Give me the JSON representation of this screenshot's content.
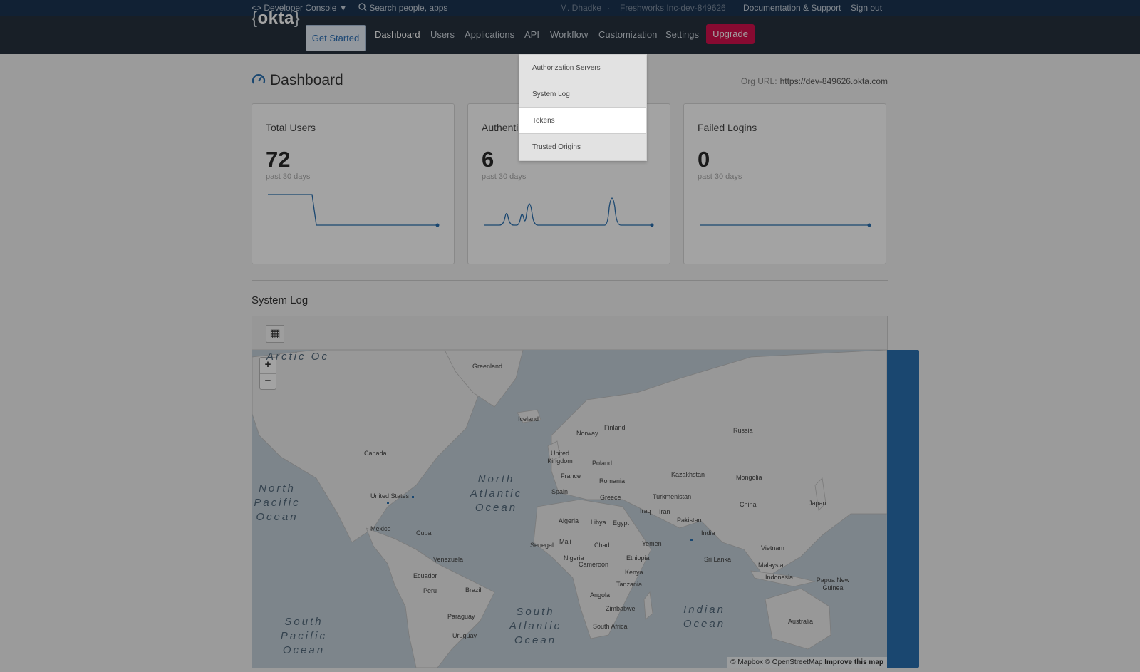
{
  "topbar": {
    "console_label": "Developer Console",
    "search_placeholder": "Search people, apps",
    "user": "M. Dhadke",
    "org": "Freshworks Inc-dev-849626",
    "docs": "Documentation & Support",
    "signout": "Sign out"
  },
  "nav": {
    "logo": "okta",
    "get_started": "Get Started",
    "links": [
      "Dashboard",
      "Users",
      "Applications",
      "API",
      "Workflow",
      "Customization",
      "Settings"
    ],
    "upgrade": "Upgrade",
    "api_menu": [
      "Authorization Servers",
      "System Log",
      "Tokens",
      "Trusted Origins"
    ],
    "highlighted_menu_item": "Tokens"
  },
  "page": {
    "title": "Dashboard",
    "org_url_label": "Org URL:",
    "org_url": "https://dev-849626.okta.com"
  },
  "cards": [
    {
      "title": "Total Users",
      "value": "72",
      "sub": "past 30 days"
    },
    {
      "title": "Authenti",
      "value": "6",
      "sub": "past 30 days"
    },
    {
      "title": "Failed Logins",
      "value": "0",
      "sub": "past 30 days"
    }
  ],
  "system_log": {
    "title": "System Log",
    "map_labels": [
      "Greenland",
      "Iceland",
      "Norway",
      "Finland",
      "Russia",
      "Canada",
      "United Kingdom",
      "Poland",
      "Kazakhstan",
      "Mongolia",
      "France",
      "Romania",
      "United States",
      "Spain",
      "Greece",
      "Turkmenistan",
      "China",
      "Japan",
      "Iraq",
      "Iran",
      "Algeria",
      "Libya",
      "Egypt",
      "Pakistan",
      "Mexico",
      "Cuba",
      "India",
      "Senegal",
      "Mali",
      "Chad",
      "Yemen",
      "Nigeria",
      "Venezuela",
      "Cameroon",
      "Ethiopia",
      "Sri Lanka",
      "Vietnam",
      "Malaysia",
      "Kenya",
      "Ecuador",
      "Indonesia",
      "Tanzania",
      "Peru",
      "Brazil",
      "Papua New Guinea",
      "Angola",
      "Zimbabwe",
      "Paraguay",
      "South Africa",
      "Uruguay",
      "Australia"
    ],
    "oceans": [
      "North Pacific Ocean",
      "North Atlantic Ocean",
      "South Atlantic Ocean",
      "Indian Ocean",
      "South Pacific Ocean",
      "Arctic Oc"
    ],
    "zoom_in": "+",
    "zoom_out": "−",
    "attribution": "© Mapbox © OpenStreetMap",
    "improve": "Improve this map"
  },
  "colors": {
    "nav_bg": "#26313d",
    "topbar_bg": "#1b3552",
    "upgrade": "#d4114e",
    "accent": "#2a6fb0"
  }
}
